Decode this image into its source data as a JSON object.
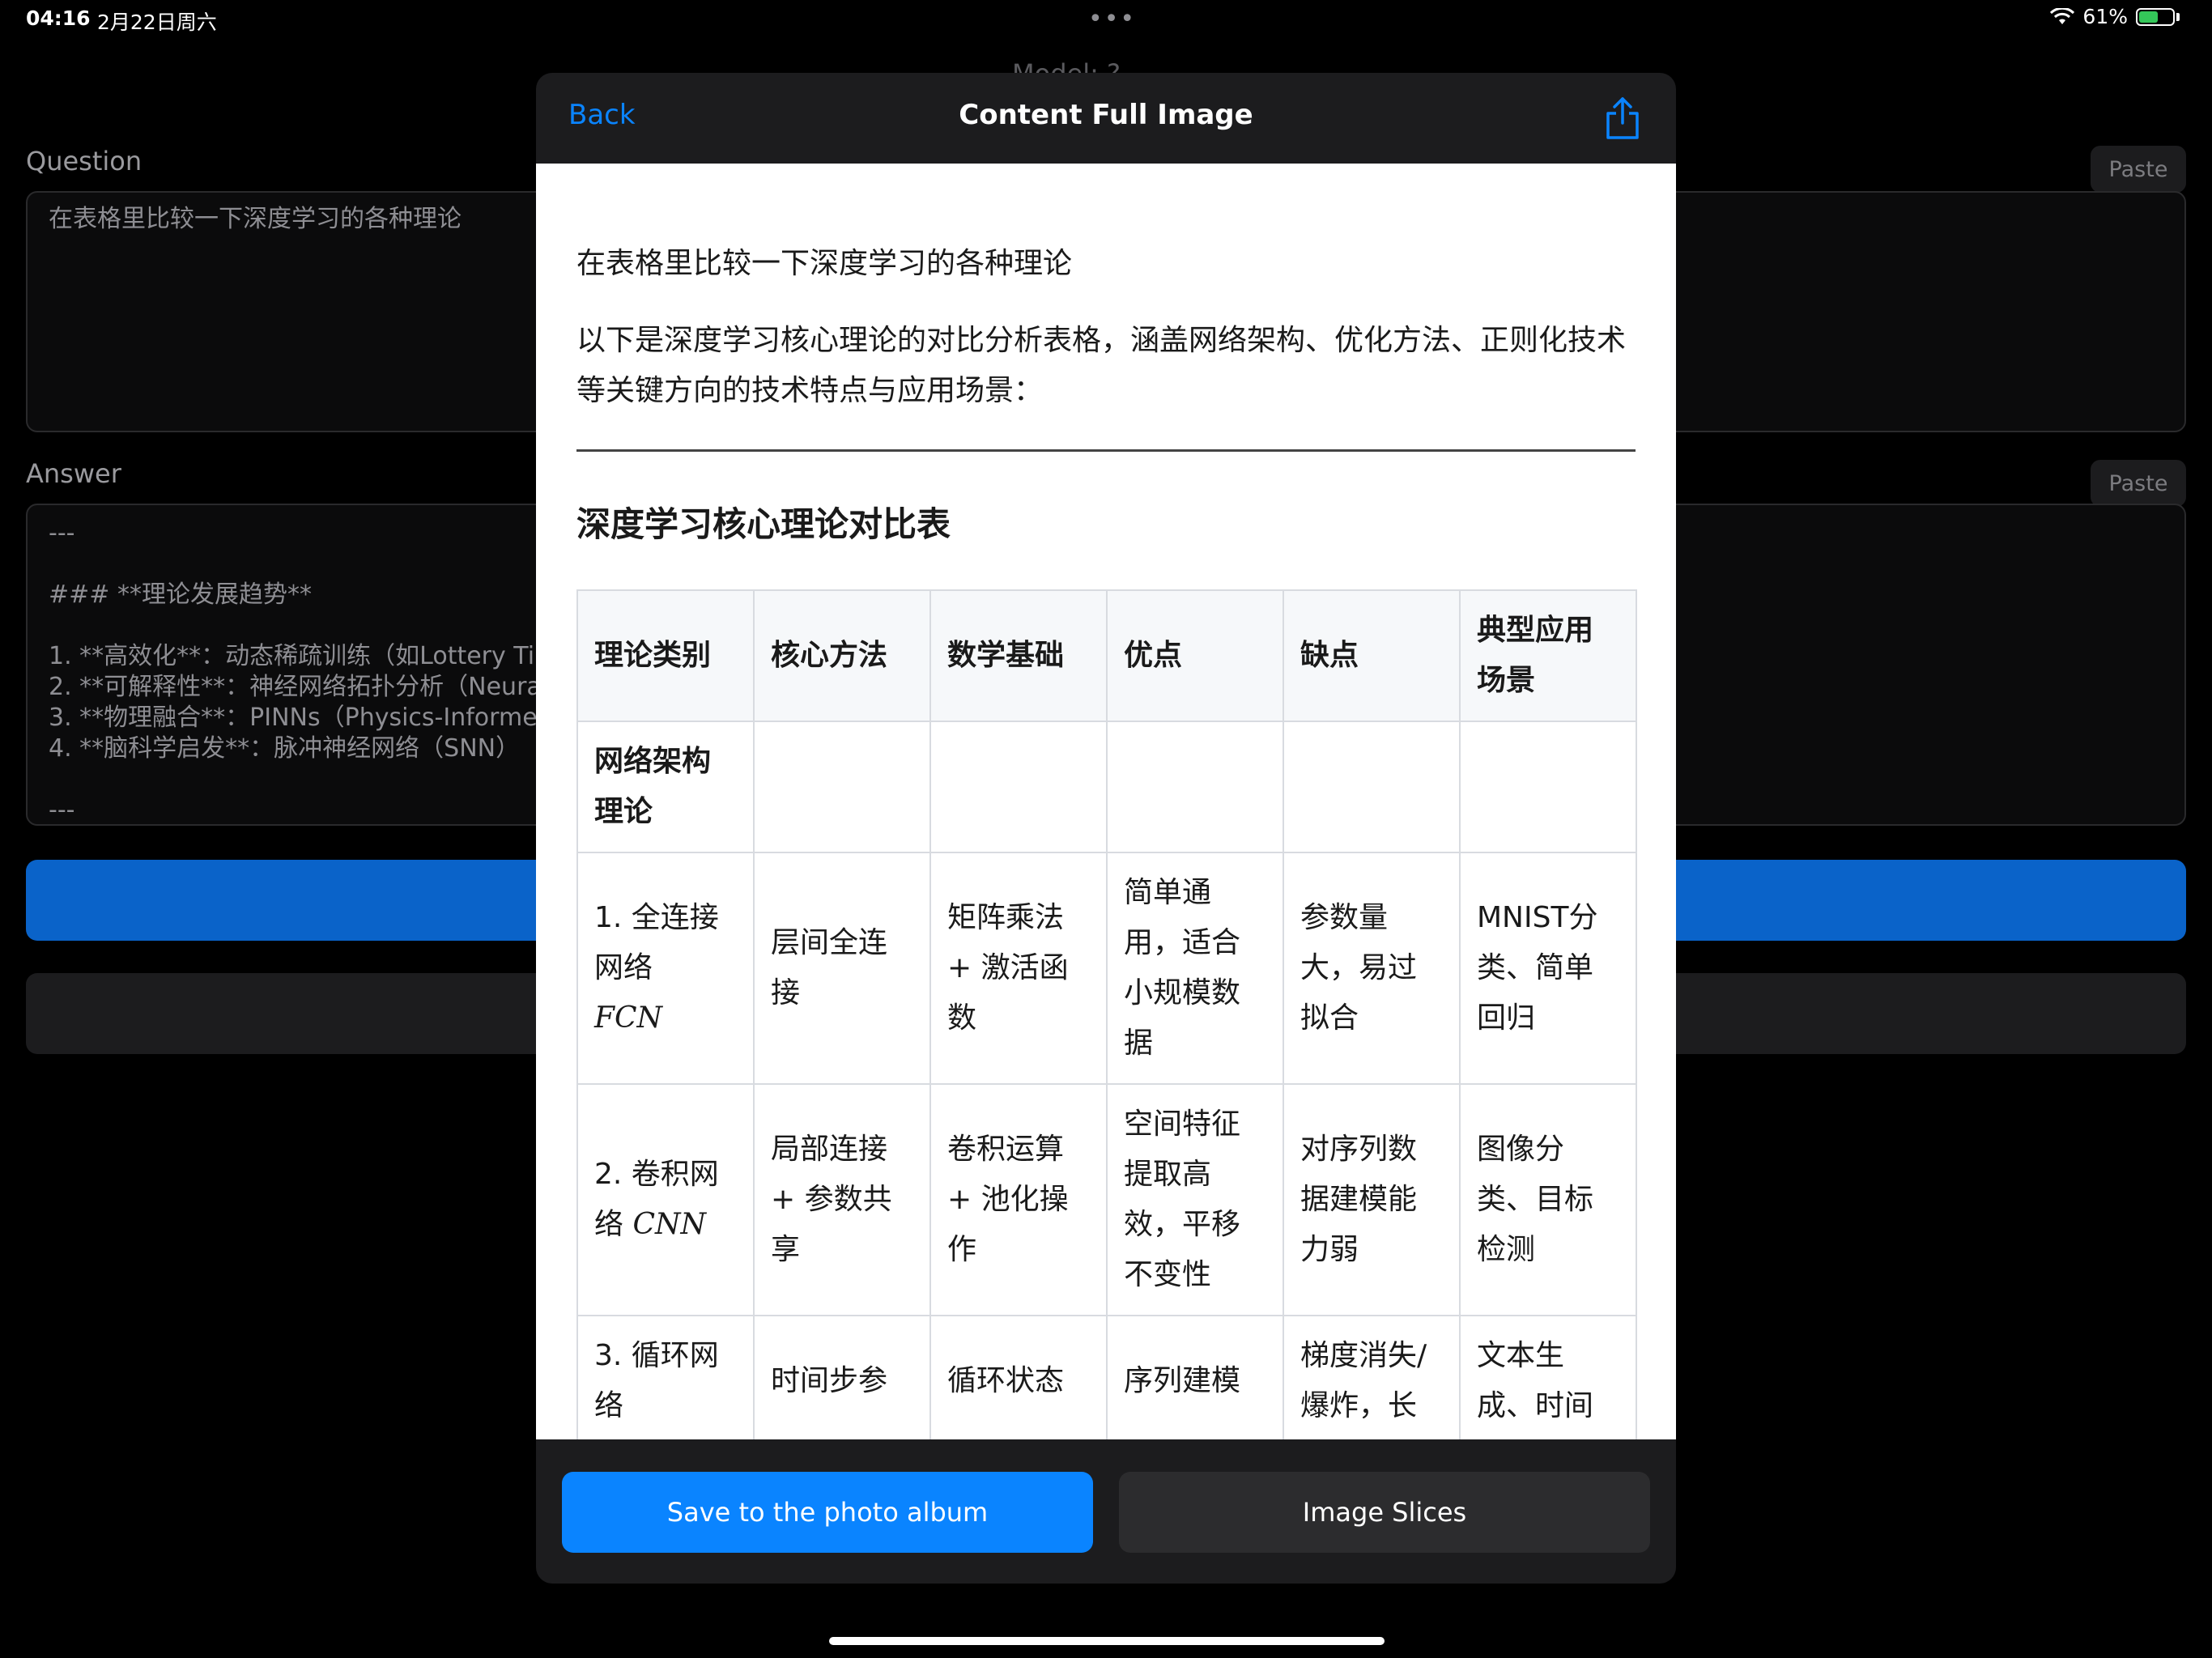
{
  "status_bar": {
    "time": "04:16",
    "date": "2月22日周六",
    "more": "•••",
    "battery_percent": "61%",
    "battery_level": 0.61
  },
  "background": {
    "title": "Model: ?",
    "question_label": "Question",
    "question_text": "在表格里比较一下深度学习的各种理论",
    "answer_label": "Answer",
    "answer_text": "---\n\n### **理论发展趋势**\n\n1. **高效化**：动态稀疏训练（如Lottery Ti\n2. **可解释性**：神经网络拓扑分析（Neura\n3. **物理融合**：PINNs（Physics-Informe\n4. **脑科学启发**：脉冲神经网络（SNN）\n\n---",
    "paste_label": "Paste",
    "accent_color": "#0a63c9"
  },
  "modal": {
    "back_label": "Back",
    "title": "Content Full Image",
    "share_icon": "share-icon",
    "content": {
      "question": "在表格里比较一下深度学习的各种理论",
      "intro": "以下是深度学习核心理论的对比分析表格，涵盖网络架构、优化方法、正则化技术等关键方向的技术特点与应用场景：",
      "table_title": "深度学习核心理论对比表",
      "headers": [
        "理论类别",
        "核心方法",
        "数学基础",
        "优点",
        "缺点",
        "典型应用场景"
      ],
      "category_row": "网络架构理论",
      "rows": [
        {
          "name": "1. 全连接网络",
          "math": "FCN",
          "method": "层间全连接",
          "basis": "矩阵乘法 + 激活函数",
          "pros": "简单通用，适合小规模数据",
          "cons": "参数量大，易过拟合",
          "apps": "MNIST分类、简单回归"
        },
        {
          "name": "2. 卷积网络",
          "math": "CNN",
          "method": "局部连接 + 参数共享",
          "basis": "卷积运算 + 池化操作",
          "pros": "空间特征提取高效，平移不变性",
          "cons": "对序列数据建模能力弱",
          "apps": "图像分类、目标检测"
        },
        {
          "name": "3. 循环网络",
          "math": "",
          "method": "时间步参",
          "basis": "循环状态",
          "pros": "序列建模",
          "cons": "梯度消失/爆炸，长",
          "apps": "文本生成、时间"
        }
      ]
    },
    "save_label": "Save to the photo album",
    "slices_label": "Image Slices"
  }
}
